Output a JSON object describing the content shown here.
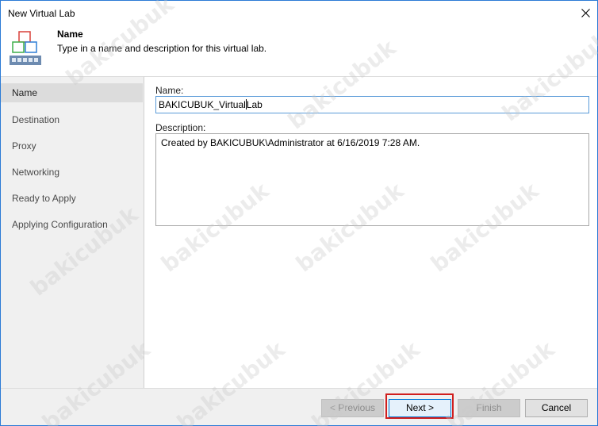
{
  "window": {
    "title": "New Virtual Lab"
  },
  "header": {
    "title": "Name",
    "description": "Type in a name and description for this virtual lab."
  },
  "sidebar": {
    "items": [
      {
        "label": "Name",
        "active": true
      },
      {
        "label": "Destination",
        "active": false
      },
      {
        "label": "Proxy",
        "active": false
      },
      {
        "label": "Networking",
        "active": false
      },
      {
        "label": "Ready to Apply",
        "active": false
      },
      {
        "label": "Applying Configuration",
        "active": false
      }
    ]
  },
  "form": {
    "name_label": "Name:",
    "name_value_before_caret": "BAKICUBUK_Virtual",
    "name_value_after_caret": "Lab",
    "description_label": "Description:",
    "description_value": "Created by BAKICUBUK\\Administrator at 6/16/2019 7:28 AM."
  },
  "buttons": {
    "previous": "< Previous",
    "next": "Next >",
    "finish": "Finish",
    "cancel": "Cancel"
  },
  "watermark": {
    "text": "bakicubuk"
  },
  "icons": {
    "close": "close-icon",
    "wizard": "virtual-lab-icon"
  },
  "colors": {
    "accent": "#0078d7",
    "highlight": "#d01e1e",
    "sidebar_bg": "#f0f0f0",
    "active_item_bg": "#dcdcdc"
  }
}
